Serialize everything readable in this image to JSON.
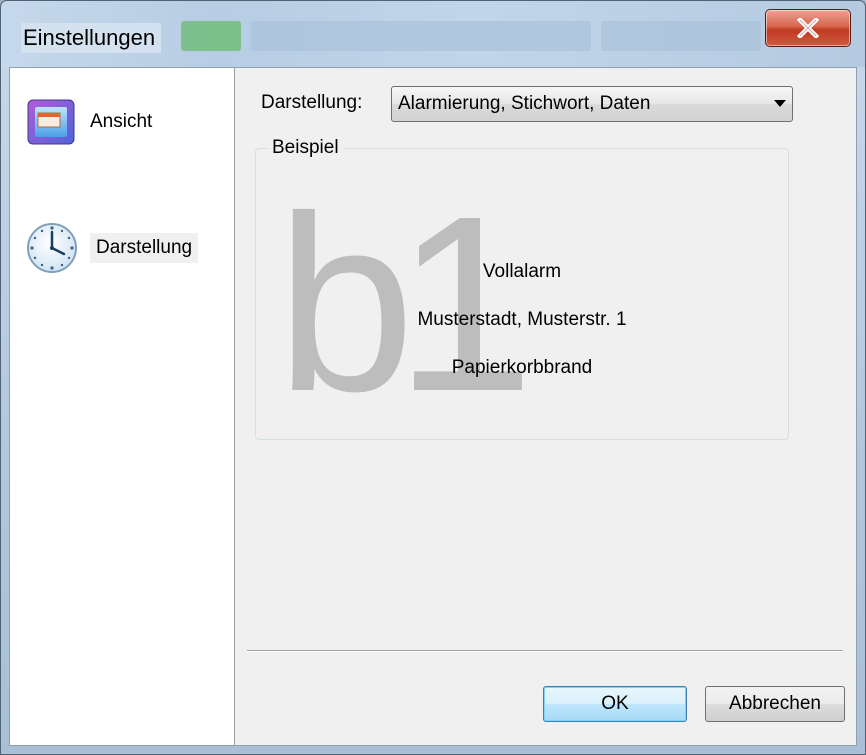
{
  "window": {
    "title": "Einstellungen",
    "close_label": "x"
  },
  "sidebar": {
    "items": [
      {
        "label": "Ansicht",
        "icon": "window-view-icon",
        "selected": false
      },
      {
        "label": "Darstellung",
        "icon": "clock-icon",
        "selected": true
      }
    ]
  },
  "main": {
    "darstellung_label": "Darstellung:",
    "darstellung_value": "Alarmierung, Stichwort, Daten",
    "example_group_title": "Beispiel",
    "example": {
      "watermark": "b1",
      "lines": [
        "Vollalarm",
        "Musterstadt, Musterstr. 1",
        "Papierkorbbrand"
      ]
    }
  },
  "buttons": {
    "ok": "OK",
    "cancel": "Abbrechen"
  },
  "colors": {
    "close_button": "#c8432b",
    "default_button_border": "#3c7fb1",
    "watermark": "#bdbdbd"
  }
}
